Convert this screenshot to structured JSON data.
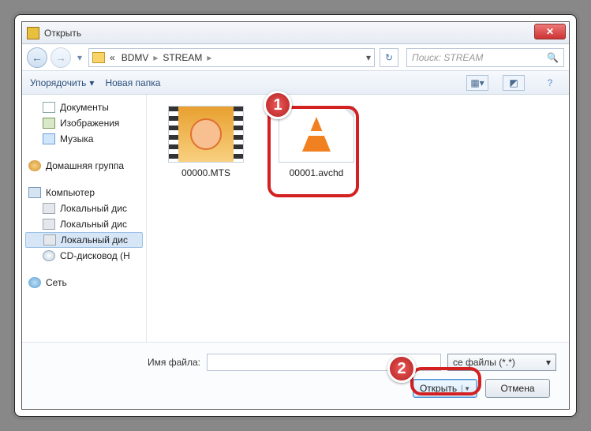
{
  "window": {
    "title": "Открыть"
  },
  "nav": {
    "crumb_prev": "«",
    "crumb1": "BDMV",
    "crumb2": "STREAM",
    "search_placeholder": "Поиск: STREAM"
  },
  "toolbar": {
    "organize": "Упорядочить",
    "newfolder": "Новая папка"
  },
  "tree": {
    "documents": "Документы",
    "images": "Изображения",
    "music": "Музыка",
    "homegroup": "Домашняя группа",
    "computer": "Компьютер",
    "drive1": "Локальный дис",
    "drive2": "Локальный дис",
    "drive3": "Локальный дис",
    "cd": "CD-дисковод (H",
    "network": "Сеть"
  },
  "files": {
    "f1": "00000.MTS",
    "f2": "00001.avchd"
  },
  "bottom": {
    "filename_label": "Имя файла:",
    "filter": "се файлы (*.*)",
    "open": "Открыть",
    "cancel": "Отмена"
  },
  "badges": {
    "b1": "1",
    "b2": "2"
  }
}
